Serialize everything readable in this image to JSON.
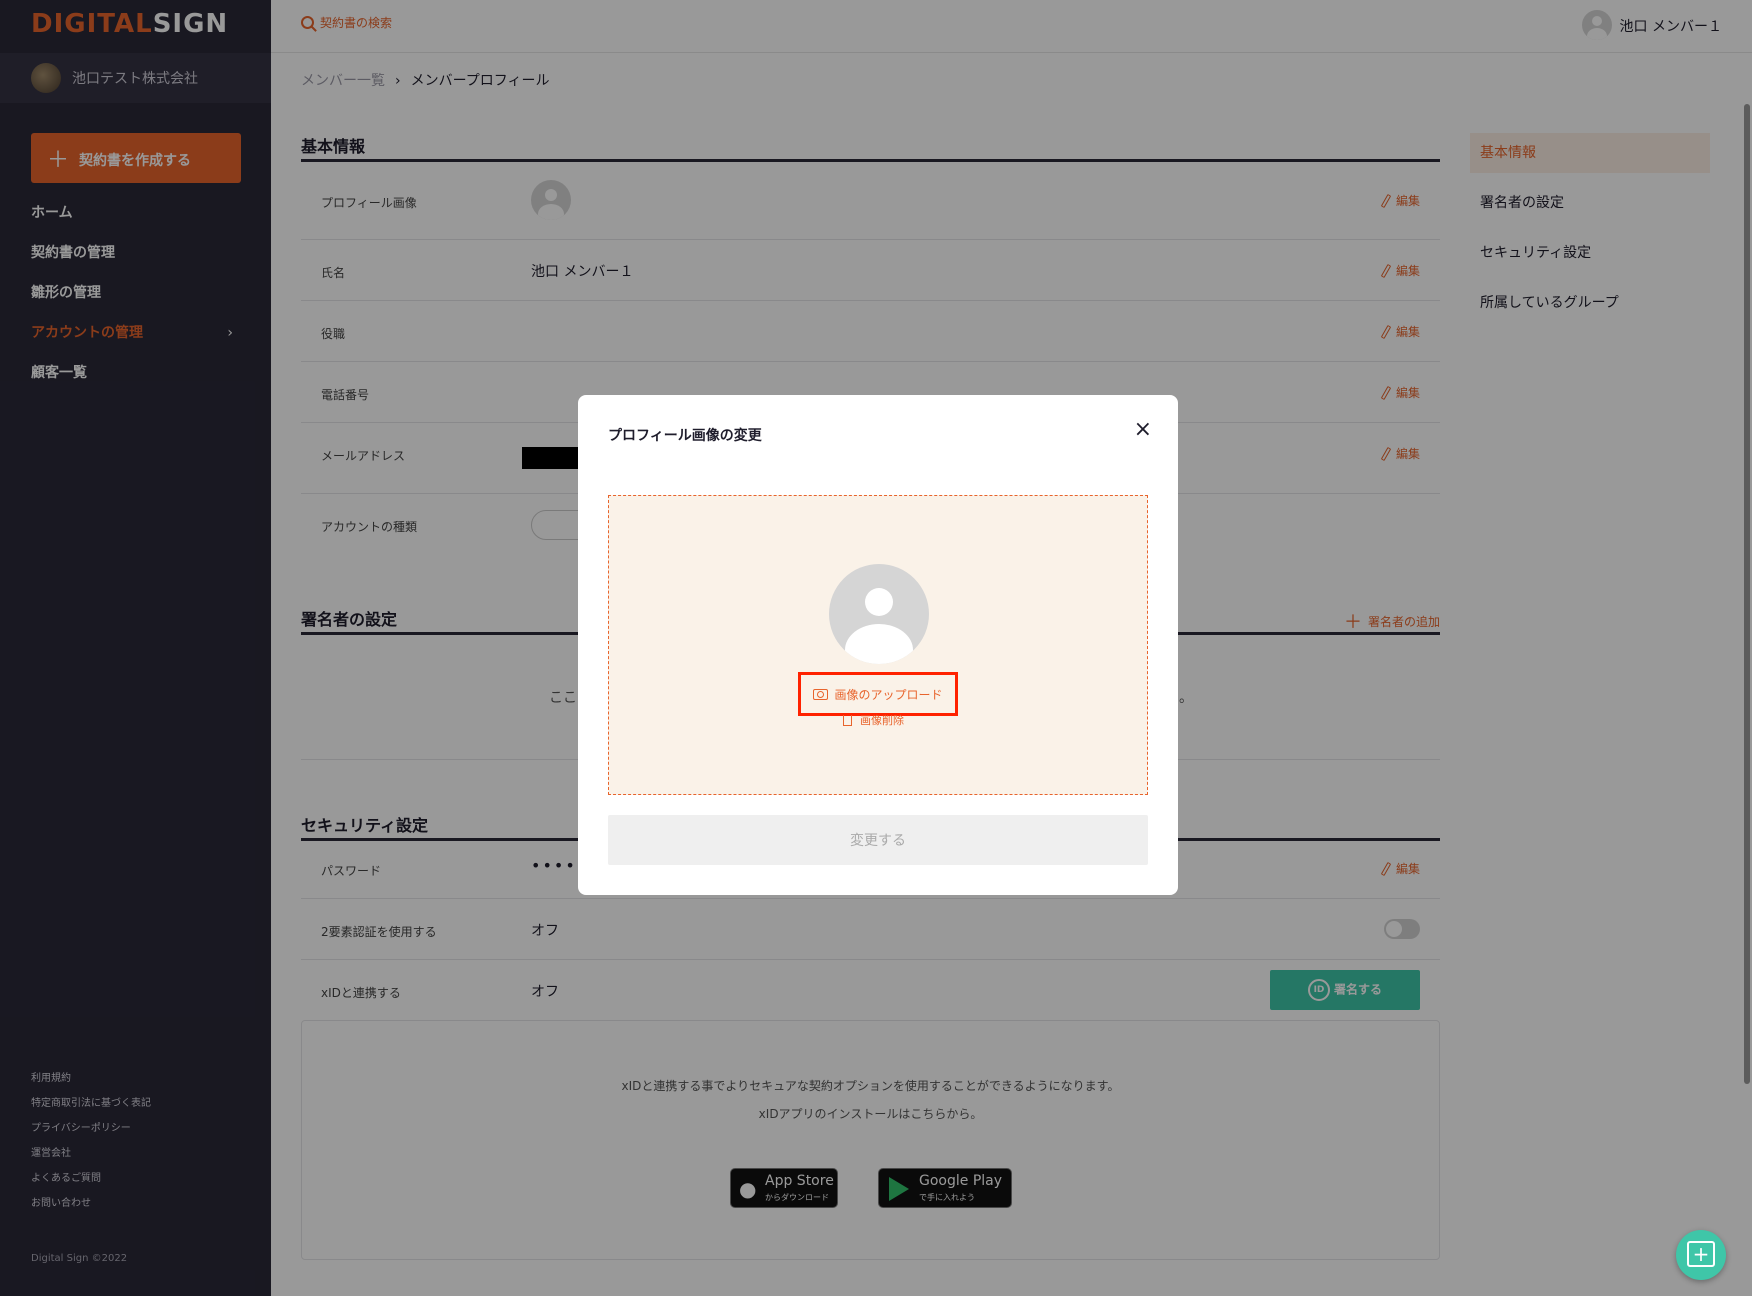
{
  "brand": {
    "logo_a": "DIGITAL",
    "logo_b": "SIGN",
    "accent": "#e8642c",
    "sidebar_bg": "#2a2838",
    "teal": "#3fc6a8"
  },
  "sidebar": {
    "company": "池口テスト株式会社",
    "create_button": "契約書を作成する",
    "items": [
      {
        "label": "ホーム",
        "active": false
      },
      {
        "label": "契約書の管理",
        "active": false
      },
      {
        "label": "雛形の管理",
        "active": false
      },
      {
        "label": "アカウントの管理",
        "active": true
      },
      {
        "label": "顧客一覧",
        "active": false
      }
    ],
    "footer_links": [
      "利用規約",
      "特定商取引法に基づく表記",
      "プライバシーポリシー",
      "運営会社",
      "よくあるご質問",
      "お問い合わせ"
    ],
    "copyright": "Digital Sign ©2022"
  },
  "topbar": {
    "search_placeholder": "契約書の検索",
    "user_name": "池口 メンバー１"
  },
  "breadcrumb": {
    "parent": "メンバー一覧",
    "current": "メンバープロフィール"
  },
  "basic_info": {
    "title": "基本情報",
    "rows": [
      {
        "label": "プロフィール画像",
        "value": ""
      },
      {
        "label": "氏名",
        "value": "池口 メンバー１"
      },
      {
        "label": "役職",
        "value": ""
      },
      {
        "label": "電話番号",
        "value": ""
      },
      {
        "label": "メールアドレス",
        "value": ""
      },
      {
        "label": "アカウントの種類",
        "value": ""
      }
    ],
    "edit_label": "編集"
  },
  "signer_settings": {
    "title": "署名者の設定",
    "add_label": "署名者の追加",
    "empty_text_left": "ここ",
    "empty_text_right": "。"
  },
  "security": {
    "title": "セキュリティ設定",
    "rows": [
      {
        "label": "パスワード",
        "value": "•••••"
      },
      {
        "label": "2要素認証を使用する",
        "value": "オフ"
      },
      {
        "label": "xIDと連携する",
        "value": "オフ"
      }
    ],
    "sign_button": "署名する",
    "id_badge": "ID",
    "xid_text_1": "xIDと連携する事でよりセキュアな契約オプションを使用することができるようになります。",
    "xid_text_2": "xIDアプリのインストールはこちらから。",
    "app_store": {
      "main": "App Store",
      "sub": "からダウンロード"
    },
    "google_play": {
      "main": "Google Play",
      "sub": "で手に入れよう"
    }
  },
  "side_nav": [
    "基本情報",
    "署名者の設定",
    "セキュリティ設定",
    "所属しているグループ"
  ],
  "modal": {
    "title": "プロフィール画像の変更",
    "upload_label": "画像のアップロード",
    "delete_label": "画像削除",
    "submit_label": "変更する",
    "close_symbol": "×"
  }
}
